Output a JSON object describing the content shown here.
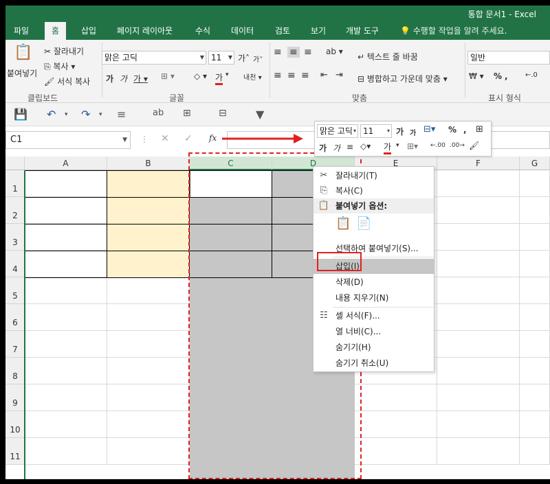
{
  "window": {
    "title": "통합 문서1 - Excel"
  },
  "tabs": [
    {
      "label": "파일"
    },
    {
      "label": "홈"
    },
    {
      "label": "삽입"
    },
    {
      "label": "페이지 레이아웃"
    },
    {
      "label": "수식"
    },
    {
      "label": "데이터"
    },
    {
      "label": "검토"
    },
    {
      "label": "보기"
    },
    {
      "label": "개발 도구"
    }
  ],
  "tell_me": "수행할 작업을 알려 주세요.",
  "ribbon": {
    "clipboard": {
      "paste": "붙여넣기",
      "cut": "잘라내기",
      "copy": "복사",
      "format_painter": "서식 복사",
      "label": "클립보드"
    },
    "font": {
      "name": "맑은 고딕",
      "size": "11",
      "label": "글꼴"
    },
    "alignment": {
      "wrap": "텍스트 줄 바꿈",
      "merge": "병합하고 가운데 맞춤",
      "label": "맞춤"
    },
    "number": {
      "format": "일반",
      "percent": "%",
      "label": "표시 형식"
    }
  },
  "name_box": "C1",
  "fx_label": "fx",
  "columns": [
    "A",
    "B",
    "C",
    "D",
    "E",
    "F",
    "G"
  ],
  "rows": [
    "1",
    "2",
    "3",
    "4",
    "5",
    "6",
    "7",
    "8",
    "9",
    "10",
    "11"
  ],
  "mini_toolbar": {
    "font": "맑은 고딕",
    "size": "11",
    "percent": "%",
    "comma": ","
  },
  "context_menu": [
    {
      "label": "잘라내기(T)",
      "icon": "scissors-icon"
    },
    {
      "label": "복사(C)",
      "icon": "copy-icon"
    },
    {
      "label": "붙여넣기 옵션:",
      "icon": "clipboard-icon"
    },
    {
      "label": "선택하여 붙여넣기(S)...",
      "icon": ""
    },
    {
      "label": "삽입(I)",
      "icon": ""
    },
    {
      "label": "삭제(D)",
      "icon": ""
    },
    {
      "label": "내용 지우기(N)",
      "icon": ""
    },
    {
      "label": "셀 서식(F)...",
      "icon": "format-cells-icon"
    },
    {
      "label": "열 너비(C)...",
      "icon": ""
    },
    {
      "label": "숨기기(H)",
      "icon": ""
    },
    {
      "label": "숨기기 취소(U)",
      "icon": ""
    }
  ],
  "colors": {
    "excel_green": "#217346",
    "highlight_fill": "#fff2cc",
    "selection_gray": "#c6c6c6",
    "annotation_red": "#e02020"
  }
}
